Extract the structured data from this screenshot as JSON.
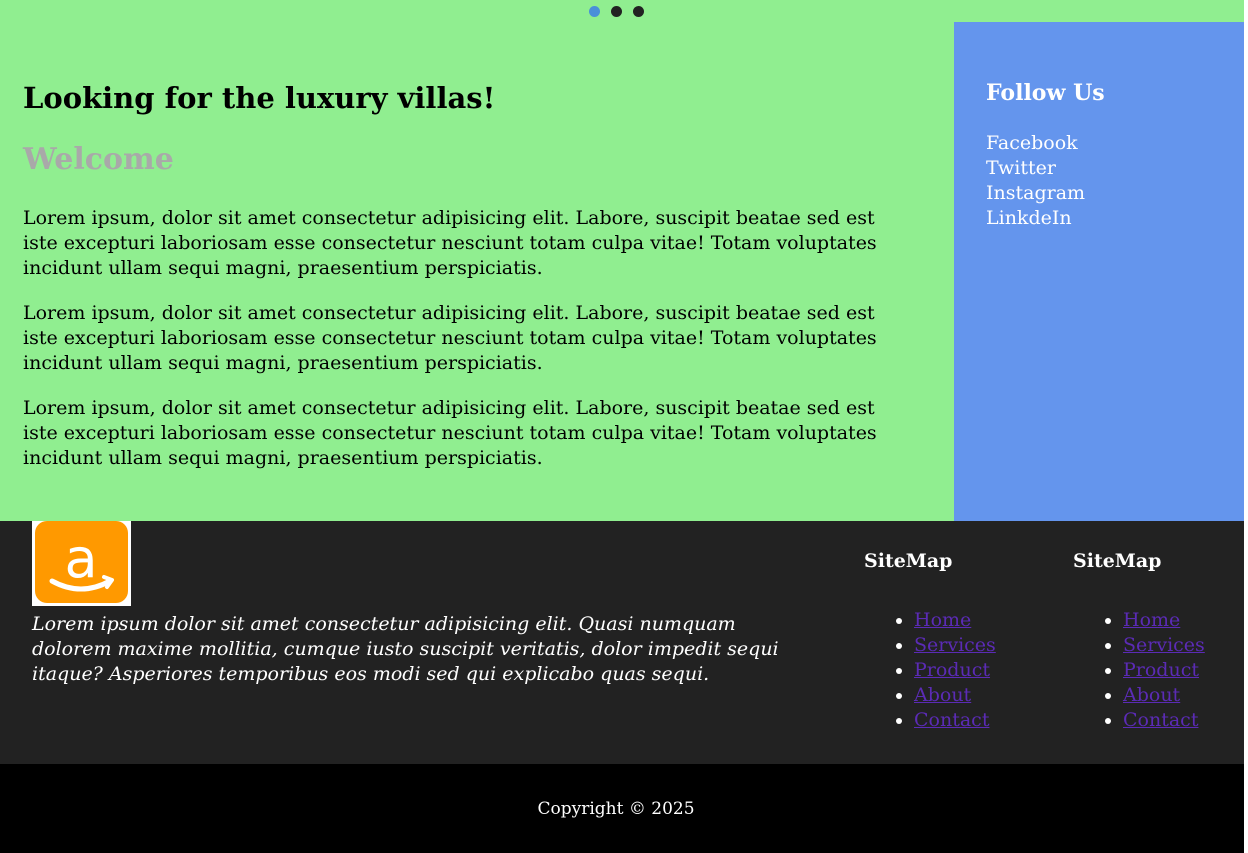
{
  "carousel": {
    "dots": 3,
    "active_index": 0,
    "active_color": "#4a90d9"
  },
  "main": {
    "title": "Looking for the luxury villas!",
    "subtitle": "Welcome",
    "paragraphs": [
      "Lorem ipsum, dolor sit amet consectetur adipisicing elit. Labore, suscipit beatae sed est iste excepturi laboriosam esse consectetur nesciunt totam culpa vitae! Totam voluptates incidunt ullam sequi magni, praesentium perspiciatis.",
      "Lorem ipsum, dolor sit amet consectetur adipisicing elit. Labore, suscipit beatae sed est iste excepturi laboriosam esse consectetur nesciunt totam culpa vitae! Totam voluptates incidunt ullam sequi magni, praesentium perspiciatis.",
      "Lorem ipsum, dolor sit amet consectetur adipisicing elit. Labore, suscipit beatae sed est iste excepturi laboriosam esse consectetur nesciunt totam culpa vitae! Totam voluptates incidunt ullam sequi magni, praesentium perspiciatis."
    ]
  },
  "aside": {
    "title": "Follow Us",
    "links": [
      "Facebook",
      "Twitter",
      "Instagram",
      "LinkdeIn"
    ]
  },
  "footer": {
    "logo_icon": "amazon-logo-icon",
    "text": "Lorem ipsum dolor sit amet consectetur adipisicing elit. Quasi numquam dolorem maxime mollitia, cumque iusto suscipit veritatis, dolor impedit sequi itaque? Asperiores temporibus eos modi sed qui explicabo quas sequi.",
    "sitemaps": [
      {
        "title": "SiteMap",
        "links": [
          "Home",
          "Services",
          "Product",
          "About",
          "Contact"
        ]
      },
      {
        "title": "SiteMap",
        "links": [
          "Home",
          "Services",
          "Product",
          "About",
          "Contact"
        ]
      }
    ]
  },
  "copyright": "Copyright © 2025",
  "colors": {
    "main_bg": "#90ee90",
    "aside_bg": "#6495ed",
    "footer_bg": "#222222",
    "copyright_bg": "#000000",
    "subtitle": "#a9a9a9",
    "link": "#5b2bb5"
  }
}
